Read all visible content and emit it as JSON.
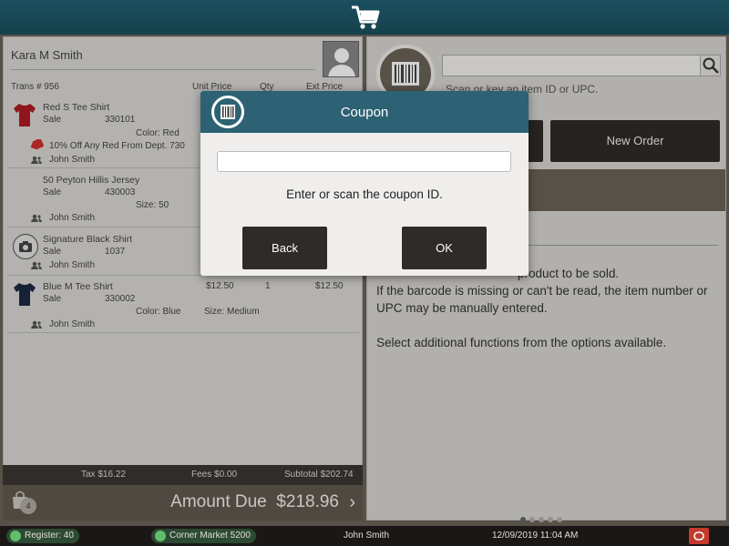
{
  "customer": {
    "name": "Kara M Smith"
  },
  "transaction": {
    "label": "Trans # 956",
    "col_unit_price": "Unit Price",
    "col_qty": "Qty",
    "col_ext_price": "Ext Price"
  },
  "items": [
    {
      "name": "Red S Tee Shirt",
      "type": "Sale",
      "sku": "330101",
      "color": "Color: Red",
      "discount": "10% Off Any Red From Dept. 730",
      "associate": "John Smith"
    },
    {
      "name": "50 Peyton Hillis Jersey",
      "type": "Sale",
      "sku": "430003",
      "size": "Size: 50",
      "associate": "John Smith"
    },
    {
      "name": "Signature Black Shirt",
      "type": "Sale",
      "sku": "1037",
      "associate": "John Smith"
    },
    {
      "name": "Blue M Tee Shirt",
      "type": "Sale",
      "sku": "330002",
      "color": "Color: Blue",
      "size": "Size: Medium",
      "unit_price": "$12.50",
      "qty": "1",
      "ext_price": "$12.50",
      "associate": "John Smith"
    }
  ],
  "totals": {
    "tax": "Tax $16.22",
    "fees": "Fees $0.00",
    "subtotal": "Subtotal $202.74"
  },
  "amount_due": "Amount Due  $218.96",
  "bag_count": "4",
  "scan": {
    "hint": "Scan or key an item ID or UPC."
  },
  "buttons": {
    "new_order": "New Order"
  },
  "instructions": {
    "line1": "product to be sold.",
    "line2": "If the barcode is missing or can't be read, the item number or UPC may be manually entered.",
    "line3": "Select additional functions from the options available."
  },
  "modal": {
    "title": "Coupon",
    "input_value": "",
    "prompt": "Enter or scan the coupon ID.",
    "back_label": "Back",
    "ok_label": "OK"
  },
  "status": {
    "register": "Register: 40",
    "store": "Corner Market 5200",
    "user": "John Smith",
    "datetime": "12/09/2019 11:04 AM"
  },
  "colors": {
    "header": "#1a4f5e",
    "modal_header": "#2c6273",
    "button_dark": "#2f2b28",
    "status_ok": "#5fbf6a",
    "power": "#c43a2f"
  },
  "icons": [
    "cart-icon",
    "person-icon",
    "barcode-icon",
    "search-icon",
    "shirt-icon",
    "camera-icon",
    "tag-icon",
    "bag-icon",
    "chevron-right-icon",
    "check-icon",
    "power-icon"
  ]
}
